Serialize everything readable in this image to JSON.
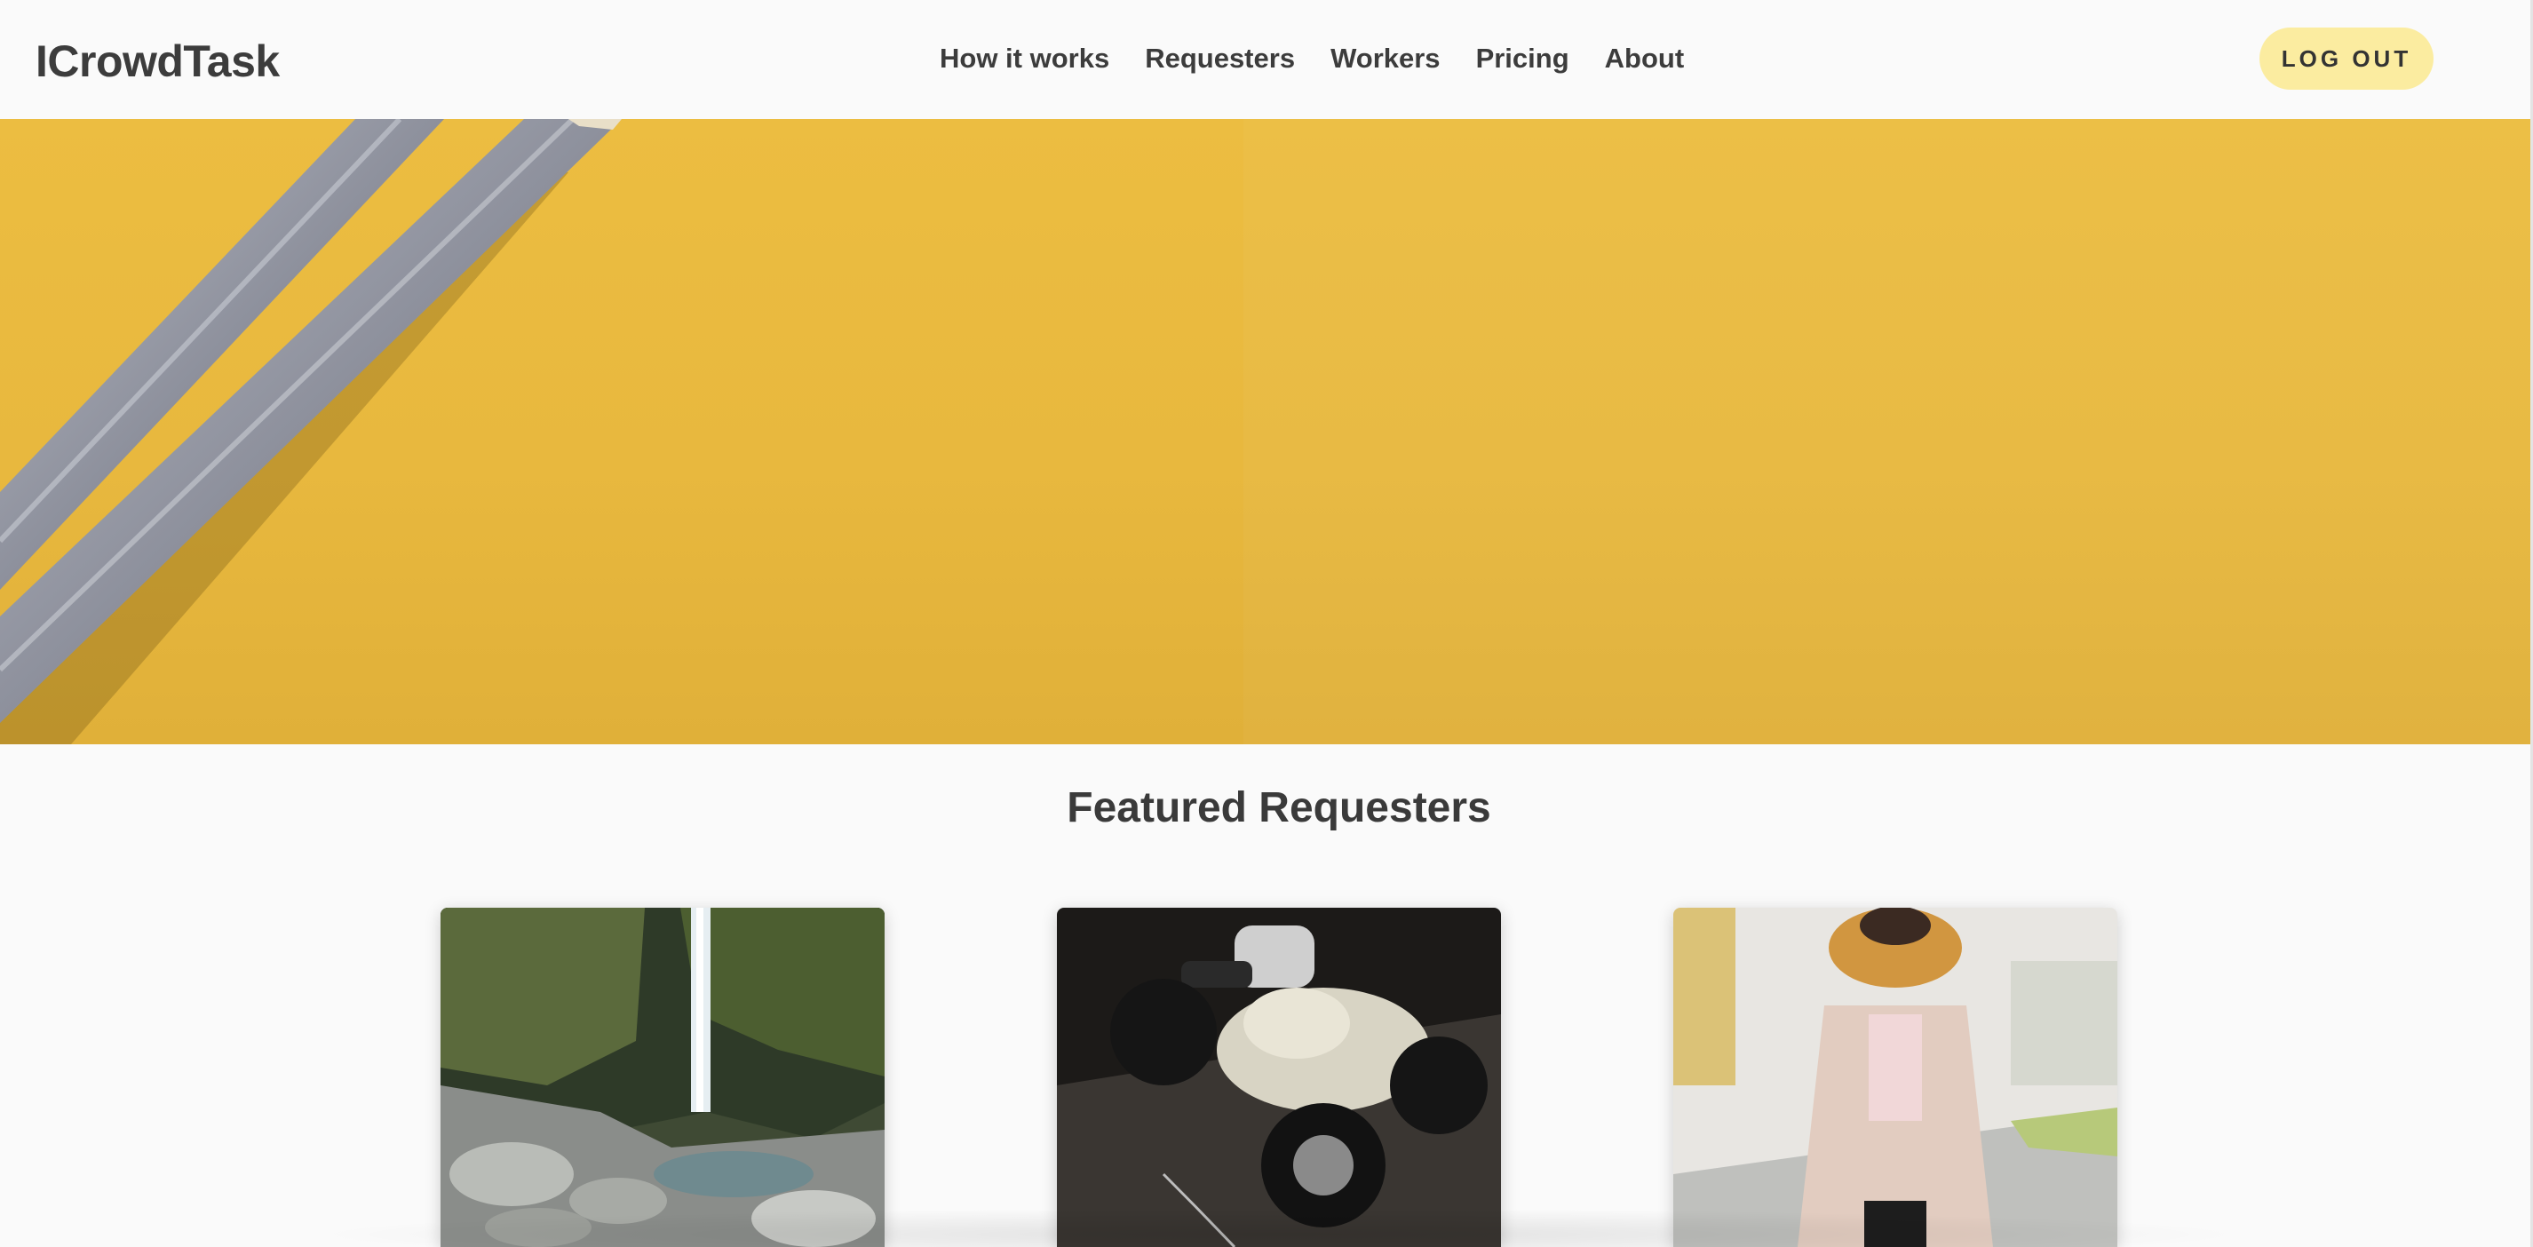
{
  "header": {
    "logo": "ICrowdTask",
    "nav": [
      "How it works",
      "Requesters",
      "Workers",
      "Pricing",
      "About"
    ],
    "logout_label": "LOG OUT"
  },
  "hero": {
    "image": "yellow-paper-with-pencils"
  },
  "featured": {
    "title": "Featured Requesters",
    "cards": [
      {
        "image": "waterfall-photo"
      },
      {
        "image": "atv-rider-photo"
      },
      {
        "image": "woman-in-coat-photo"
      }
    ]
  },
  "colors": {
    "hero_yellow": "#ecbd41",
    "logout_bg": "#fbeca0",
    "page_bg": "#fafafa",
    "text": "#3c3c3c"
  }
}
